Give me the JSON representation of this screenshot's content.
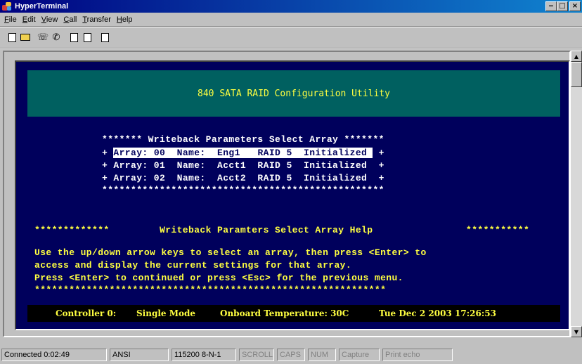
{
  "window": {
    "title": "HyperTerminal",
    "controls": [
      "minimize",
      "maximize",
      "close"
    ]
  },
  "menu": [
    {
      "label": "File",
      "accel": "F"
    },
    {
      "label": "Edit",
      "accel": "E"
    },
    {
      "label": "View",
      "accel": "V"
    },
    {
      "label": "Call",
      "accel": "C"
    },
    {
      "label": "Transfer",
      "accel": "T"
    },
    {
      "label": "Help",
      "accel": "H"
    }
  ],
  "toolbar": {
    "buttons": [
      "new-icon",
      "open-icon",
      "phone-icon",
      "disconnect-icon",
      "send-icon",
      "receive-icon",
      "properties-icon"
    ]
  },
  "terminal": {
    "header": "840 SATA RAID Configuration Utility",
    "select_title": "******* Writeback Parameters Select Array *******",
    "arrays": [
      {
        "line": "+ Array: 00  Name:  Eng1   RAID 5  Initialized  +",
        "selected_part": "Array: 00  Name:  Eng1   RAID 5  Initialized ",
        "selected": true
      },
      {
        "line": "+ Array: 01  Name:  Acct1  RAID 5  Initialized  +",
        "selected": false
      },
      {
        "line": "+ Array: 02  Name:  Acct2  RAID 5  Initialized  +",
        "selected": false
      }
    ],
    "select_border": "*************************************************",
    "help_title_left": "*************",
    "help_title": "Writeback Paramters Select Array Help",
    "help_title_right": "***********",
    "help_lines": [
      "Use the up/down arrow keys to select an array, then press <Enter> to",
      "access and display the current settings for that array.",
      "Press <Enter> to continued or press <Esc> for the previous menu."
    ],
    "help_border": "*************************************************************",
    "status": {
      "controller": "Controller 0:",
      "mode": "Single Mode",
      "temperature": "Onboard Temperature: 30C",
      "datetime": "Tue Dec 2 2003  17:26:53"
    }
  },
  "statusbar": {
    "connected": "Connected 0:02:49",
    "emulation": "ANSI",
    "settings": "115200 8-N-1",
    "scroll": "SCROLL",
    "caps": "CAPS",
    "num": "NUM",
    "capture": "Capture",
    "print_echo": "Print echo"
  }
}
